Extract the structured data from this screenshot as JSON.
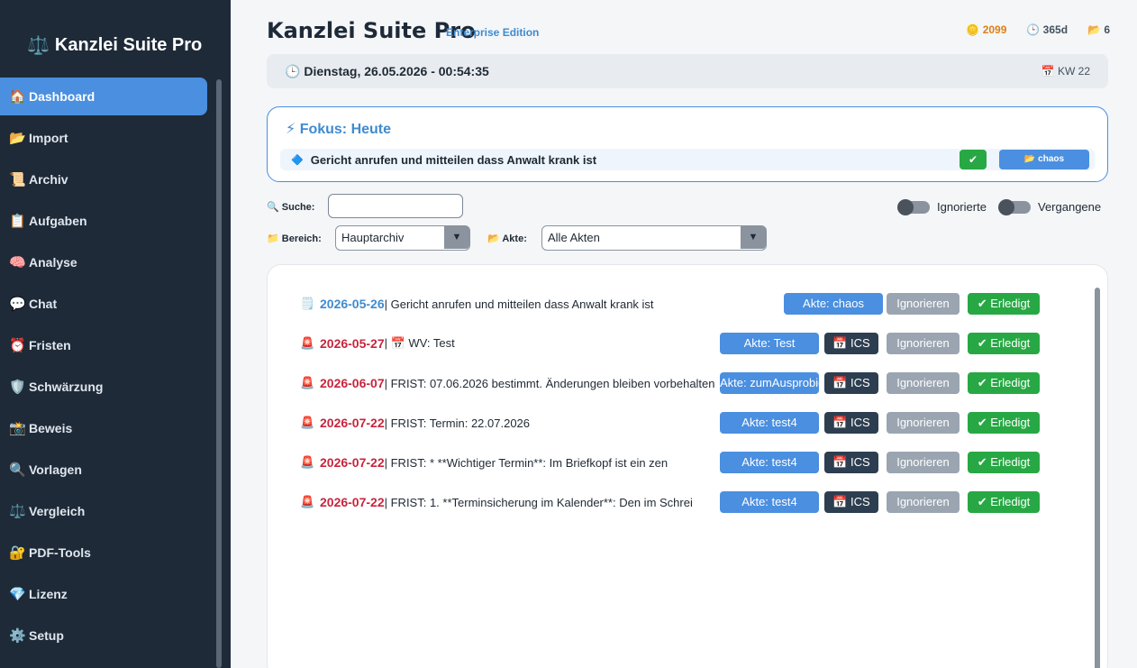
{
  "app": {
    "name": "Kanzlei Suite Pro",
    "brand_icon": "⚖️",
    "edition": "Enterprise Edition"
  },
  "stats": {
    "coins": "2099",
    "days": "365d",
    "files": "6"
  },
  "sidebar": {
    "items": [
      {
        "icon": "🏠",
        "label": "Dashboard",
        "active": true
      },
      {
        "icon": "📂",
        "label": "Import"
      },
      {
        "icon": "📜",
        "label": "Archiv"
      },
      {
        "icon": "📋",
        "label": "Aufgaben"
      },
      {
        "icon": "🧠",
        "label": "Analyse"
      },
      {
        "icon": "💬",
        "label": "Chat"
      },
      {
        "icon": "⏰",
        "label": "Fristen"
      },
      {
        "icon": "🛡️",
        "label": "Schwärzung"
      },
      {
        "icon": "📸",
        "label": "Beweis"
      },
      {
        "icon": "🔍",
        "label": "Vorlagen"
      },
      {
        "icon": "⚖️",
        "label": "Vergleich"
      },
      {
        "icon": "🔐",
        "label": "PDF-Tools"
      },
      {
        "icon": "💎",
        "label": "Lizenz"
      },
      {
        "icon": "⚙️",
        "label": "Setup"
      }
    ]
  },
  "datebar": {
    "datetime": "Dienstag, 26.05.2026 - 00:54:35",
    "week": "KW 22"
  },
  "focus": {
    "title": "Fokus: Heute",
    "task": "Gericht anrufen und mitteilen dass Anwalt krank ist",
    "check_label": "✔",
    "akte_label": "chaos"
  },
  "filters": {
    "search_label": "Suche:",
    "search_value": "",
    "toggle_ignored": "Ignorierte",
    "toggle_past": "Vergangene",
    "bereich_label": "Bereich:",
    "bereich_value": "Hauptarchiv",
    "akte_label": "Akte:",
    "akte_value": "Alle Akten"
  },
  "tasks": [
    {
      "icon": "🗒️",
      "date": "2026-05-26",
      "date_color": "blue",
      "desc": "| Gericht anrufen und mitteilen dass Anwalt krank ist",
      "akte": "Akte: chaos",
      "ics": false
    },
    {
      "icon": "🚨",
      "date": "2026-05-27",
      "date_color": "red",
      "desc": "| 📅 WV: Test",
      "akte": "Akte: Test",
      "ics": true
    },
    {
      "icon": "🚨",
      "date": "2026-06-07",
      "date_color": "red",
      "desc": "| FRIST: 07.06.2026 bestimmt. Änderungen bleiben vorbehalten",
      "akte": "Akte: zumAusprobieren",
      "ics": true
    },
    {
      "icon": "🚨",
      "date": "2026-07-22",
      "date_color": "red",
      "desc": "| FRIST: Termin: 22.07.2026",
      "akte": "Akte: test4",
      "ics": true
    },
    {
      "icon": "🚨",
      "date": "2026-07-22",
      "date_color": "red",
      "desc": "| FRIST: *   **Wichtiger Termin**: Im Briefkopf ist ein zen",
      "akte": "Akte: test4",
      "ics": true
    },
    {
      "icon": "🚨",
      "date": "2026-07-22",
      "date_color": "red",
      "desc": "| FRIST: 1.  **Terminsicherung im Kalender**: Den im Schrei",
      "akte": "Akte: test4",
      "ics": true
    }
  ],
  "buttons": {
    "ics": "📅 ICS",
    "ignore": "Ignorieren",
    "done": "✔ Erledigt"
  }
}
